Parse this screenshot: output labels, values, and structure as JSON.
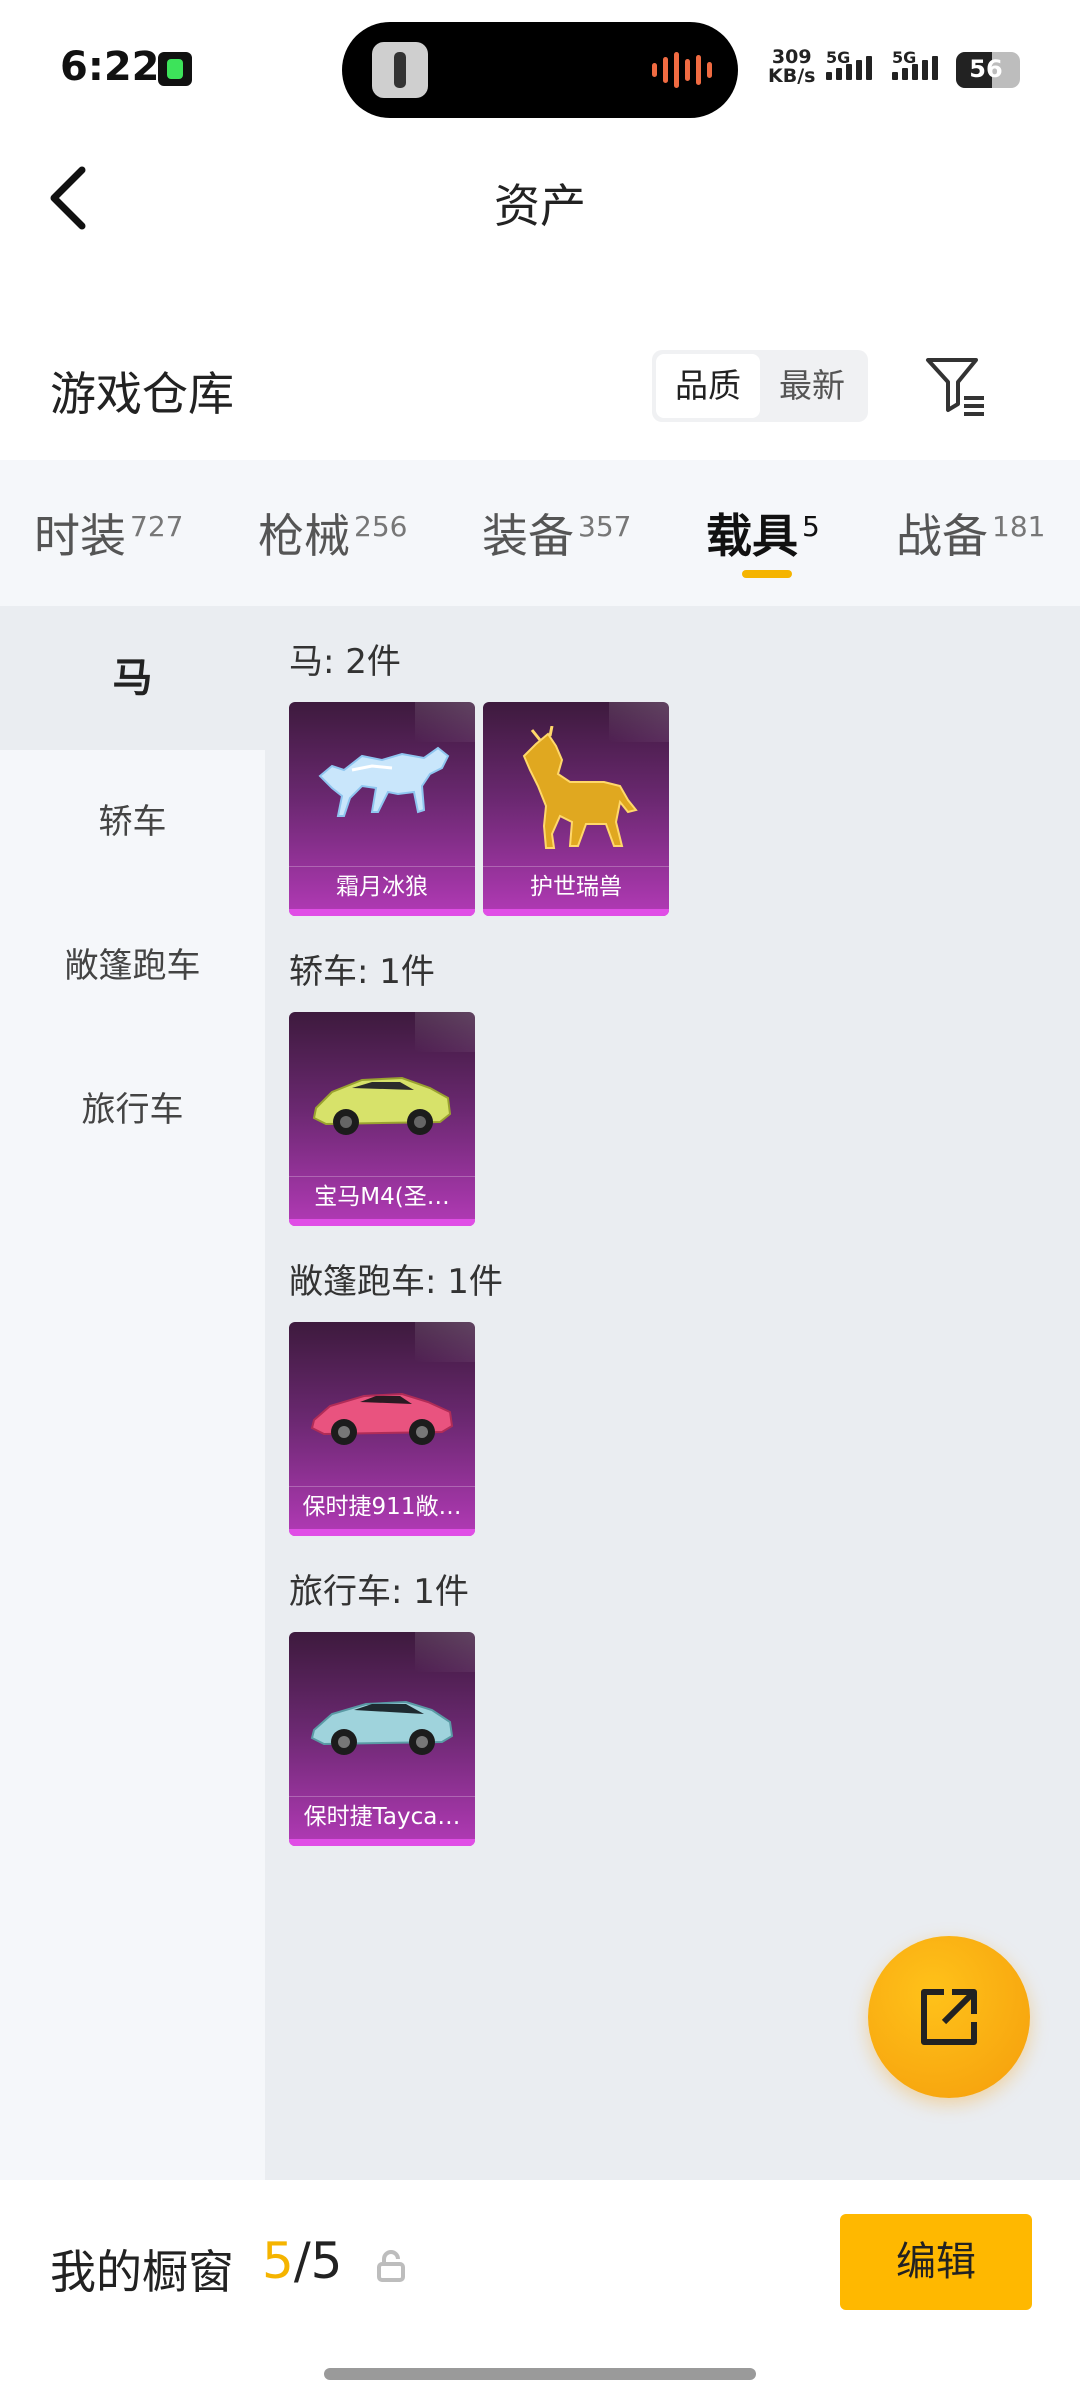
{
  "status_bar": {
    "time": "6:22",
    "net_speed_value": "309",
    "net_speed_unit": "KB/s",
    "sim1_label": "5G",
    "sim2_label": "5G",
    "battery": "56",
    "battery_level_percent": 56
  },
  "header": {
    "title": "资产"
  },
  "section": {
    "title": "游戏仓库",
    "sort_options": [
      "品质",
      "最新"
    ],
    "sort_selected": "品质"
  },
  "category_tabs": [
    {
      "label": "时装",
      "count": "727"
    },
    {
      "label": "枪械",
      "count": "256"
    },
    {
      "label": "装备",
      "count": "357"
    },
    {
      "label": "载具",
      "count": "5",
      "active": true
    },
    {
      "label": "战备",
      "count": "181"
    }
  ],
  "subnav": [
    {
      "label": "马",
      "active": true
    },
    {
      "label": "轿车"
    },
    {
      "label": "敞篷跑车"
    },
    {
      "label": "旅行车"
    }
  ],
  "groups": [
    {
      "label": "马: 2件",
      "items": [
        {
          "name": "霜月冰狼",
          "icon": "ice-wolf-icon"
        },
        {
          "name": "护世瑞兽",
          "icon": "golden-beast-icon"
        }
      ]
    },
    {
      "label": "轿车: 1件",
      "items": [
        {
          "name": "宝马M4(圣…",
          "icon": "yellow-sedan-icon"
        }
      ]
    },
    {
      "label": "敞篷跑车: 1件",
      "items": [
        {
          "name": "保时捷911敞…",
          "icon": "pink-sportscar-icon"
        }
      ]
    },
    {
      "label": "旅行车: 1件",
      "items": [
        {
          "name": "保时捷Tayca…",
          "icon": "blue-wagon-icon"
        }
      ]
    }
  ],
  "showcase": {
    "label": "我的橱窗",
    "current": "5",
    "separator": "/",
    "total": "5",
    "edit_label": "编辑"
  },
  "colors": {
    "accent": "#f5b400",
    "card_purple": "#b23ab6",
    "panel_bg": "#eaedf1"
  }
}
